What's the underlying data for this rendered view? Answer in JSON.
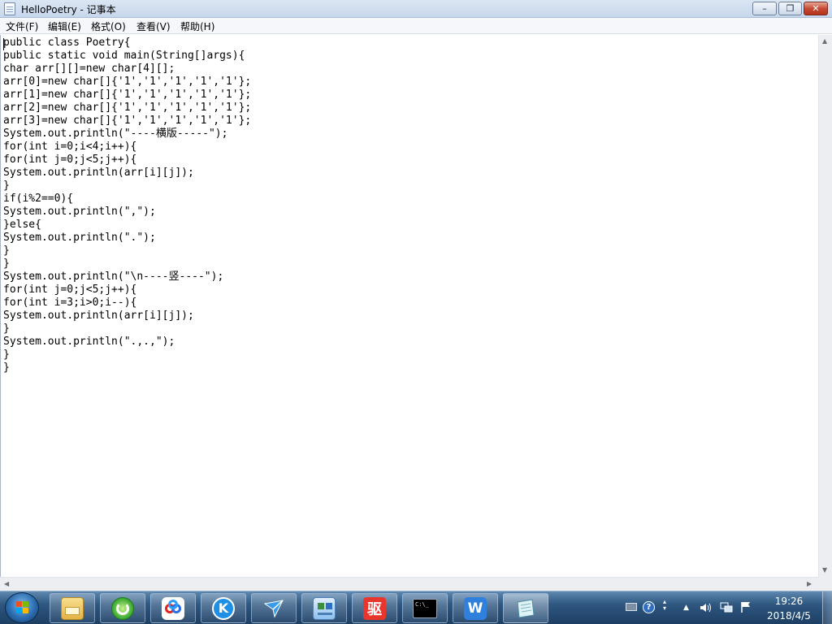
{
  "window": {
    "title": "HelloPoetry - 记事本",
    "minimize_glyph": "–",
    "maximize_glyph": "❐",
    "close_glyph": "✕"
  },
  "menu": {
    "items": [
      {
        "label": "文件(F)"
      },
      {
        "label": "编辑(E)"
      },
      {
        "label": "格式(O)"
      },
      {
        "label": "查看(V)"
      },
      {
        "label": "帮助(H)"
      }
    ]
  },
  "editor": {
    "content": "public class Poetry{\npublic static void main(String[]args){\nchar arr[][]=new char[4][];\narr[0]=new char[]{'1','1','1','1','1'};\narr[1]=new char[]{'1','1','1','1','1'};\narr[2]=new char[]{'1','1','1','1','1'};\narr[3]=new char[]{'1','1','1','1','1'};\nSystem.out.println(\"----横版-----\");\nfor(int i=0;i<4;i++){\nfor(int j=0;j<5;j++){\nSystem.out.println(arr[i][j]);\n}\nif(i%2==0){\nSystem.out.println(\",\");\n}else{\nSystem.out.println(\".\");\n}\n}\nSystem.out.println(\"\\n----竖----\");\nfor(int j=0;j<5;j++){\nfor(int i=3;i>0;i--){\nSystem.out.println(arr[i][j]);\n}\nSystem.out.println(\".,.,\");\n}\n}"
  },
  "taskbar": {
    "pinned": [
      {
        "name": "file-explorer-icon"
      },
      {
        "name": "browser-360-icon"
      },
      {
        "name": "baidu-netdisk-icon"
      },
      {
        "name": "kugou-music-icon"
      },
      {
        "name": "feige-messenger-icon"
      },
      {
        "name": "control-panel-icon"
      },
      {
        "name": "driver-wizard-icon",
        "glyph": "驱"
      },
      {
        "name": "command-prompt-icon",
        "glyph": "C:\\_"
      },
      {
        "name": "wps-writer-icon",
        "glyph": "W"
      },
      {
        "name": "notepad-icon"
      }
    ],
    "clock": {
      "time": "19:26",
      "date": "2018/4/5"
    }
  }
}
